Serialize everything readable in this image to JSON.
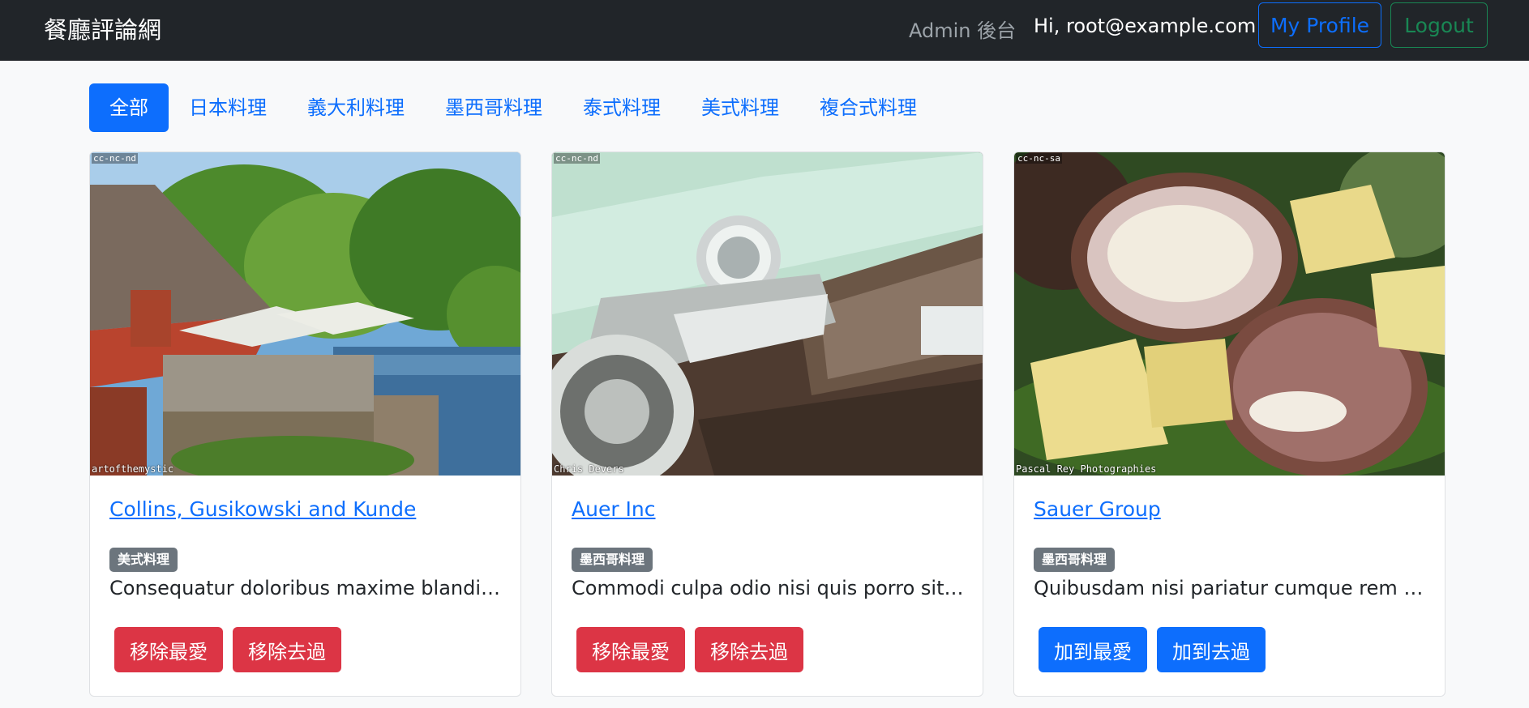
{
  "navbar": {
    "brand": "餐廳評論網",
    "admin_link": "Admin 後台",
    "greeting": "Hi, root@example.com",
    "profile_button": "My Profile",
    "logout_button": "Logout"
  },
  "categories": [
    "全部",
    "日本料理",
    "義大利料理",
    "墨西哥料理",
    "泰式料理",
    "美式料理",
    "複合式料理"
  ],
  "active_category": "全部",
  "restaurants": [
    {
      "name": "Collins, Gusikowski and Kunde",
      "category": "美式料理",
      "description": "Consequatur doloribus maxime blanditiis...",
      "image_license": "cc-nc-nd",
      "image_credit": "artofthemystic",
      "favorite_button": "移除最愛",
      "visited_button": "移除去過"
    },
    {
      "name": "Auer Inc",
      "category": "墨西哥料理",
      "description": "Commodi culpa odio nisi quis porro sit q...",
      "image_license": "cc-nc-nd",
      "image_credit": "Chris Devers",
      "favorite_button": "移除最愛",
      "visited_button": "移除去過"
    },
    {
      "name": "Sauer Group",
      "category": "墨西哥料理",
      "description": "Quibusdam nisi pariatur cumque rem inv...",
      "image_license": "cc-nc-sa",
      "image_credit": "Pascal Rey Photographies",
      "favorite_button": "加到最愛",
      "visited_button": "加到去過"
    }
  ],
  "colors": {
    "navbar": "#212529",
    "primary": "#0d6efd",
    "success": "#198754",
    "danger": "#dc3545",
    "secondary": "#6c757d",
    "background": "#f8f9fa"
  }
}
